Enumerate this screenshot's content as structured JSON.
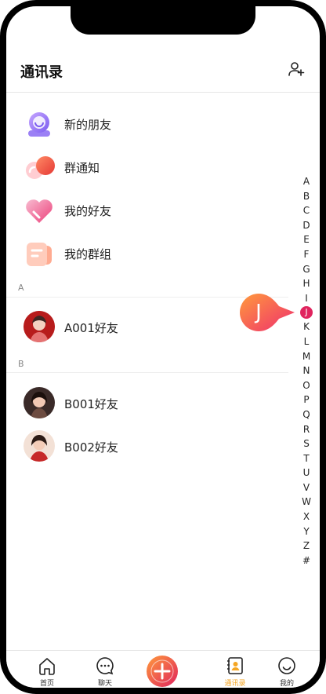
{
  "header": {
    "title": "通讯录"
  },
  "fixed_items": [
    {
      "label": "新的朋友"
    },
    {
      "label": "群通知"
    },
    {
      "label": "我的好友"
    },
    {
      "label": "我的群组"
    }
  ],
  "sections": [
    {
      "letter": "A",
      "contacts": [
        {
          "name": "A001好友"
        }
      ]
    },
    {
      "letter": "B",
      "contacts": [
        {
          "name": "B001好友"
        },
        {
          "name": "B002好友"
        }
      ]
    }
  ],
  "index": {
    "letters": [
      "A",
      "B",
      "C",
      "D",
      "E",
      "F",
      "G",
      "H",
      "I",
      "J",
      "K",
      "L",
      "M",
      "N",
      "O",
      "P",
      "Q",
      "R",
      "S",
      "T",
      "U",
      "V",
      "W",
      "X",
      "Y",
      "Z",
      "#"
    ],
    "active": "J",
    "bubble": "J"
  },
  "tabs": [
    {
      "label": "首页",
      "icon": "home-icon"
    },
    {
      "label": "聊天",
      "icon": "chat-icon"
    },
    {
      "label": "",
      "icon": "plus-icon"
    },
    {
      "label": "通讯录",
      "icon": "contacts-icon",
      "active": true
    },
    {
      "label": "我的",
      "icon": "profile-icon"
    }
  ],
  "colors": {
    "accent": "#e0245e",
    "active_tab": "#f5a623"
  }
}
